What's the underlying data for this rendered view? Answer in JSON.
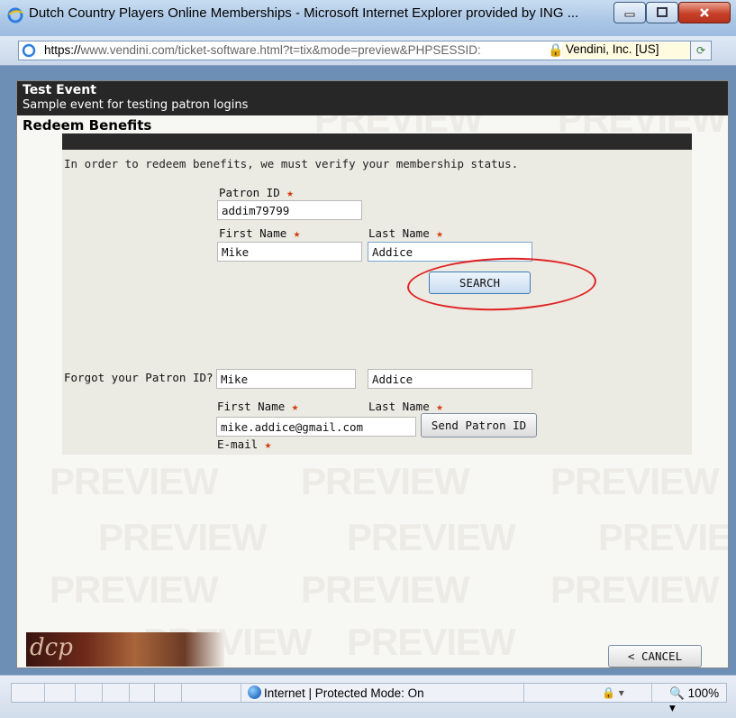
{
  "window": {
    "title": "Dutch Country Players Online Memberships - Microsoft Internet Explorer provided by ING ...",
    "address_protocol": "https://",
    "address_rest": "www.vendini.com/ticket-software.html?t=tix&mode=preview&PHPSESSID:",
    "cert_label": "Vendini, Inc. [US]"
  },
  "event": {
    "title": "Test Event",
    "subtitle": "Sample event for testing patron logins"
  },
  "section_title": "Redeem Benefits",
  "redeem": {
    "intro": "In order to redeem benefits, we must verify your membership status.",
    "patron_id_label": "Patron ID",
    "patron_id_value": "addim79799",
    "first_name_label": "First Name",
    "first_name_value": "Mike",
    "last_name_label": "Last Name",
    "last_name_value": "Addice",
    "search_label": "SEARCH"
  },
  "forgot": {
    "heading": "Forgot your Patron ID?",
    "first_name_label": "First Name",
    "first_name_value": "Mike",
    "last_name_label": "Last Name",
    "last_name_value": "Addice",
    "email_label": "E-mail",
    "email_value": "mike.addice@gmail.com",
    "send_label": "Send Patron ID"
  },
  "watermark_text": "PREVIEW",
  "logo_text": "dcp",
  "cancel_label": "< CANCEL",
  "required_mark": "★",
  "status": {
    "zone": "Internet | Protected Mode: On",
    "zoom": "100%"
  },
  "colors": {
    "header_bg": "#272727",
    "required_star": "#d23b0f",
    "annotation_circle": "#e02020"
  }
}
